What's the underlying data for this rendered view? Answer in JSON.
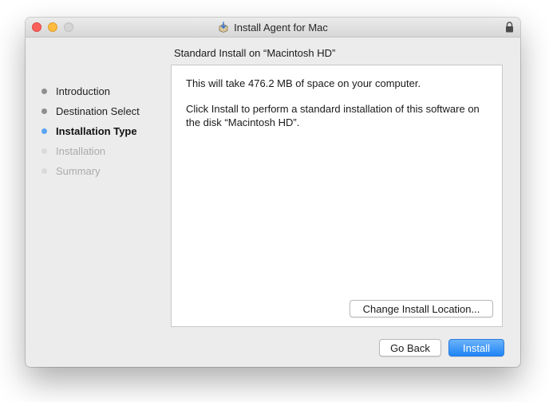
{
  "window": {
    "title": "Install Agent for Mac"
  },
  "section_title": "Standard Install on “Macintosh HD”",
  "steps": [
    {
      "label": "Introduction",
      "state": "done"
    },
    {
      "label": "Destination Select",
      "state": "done"
    },
    {
      "label": "Installation Type",
      "state": "current"
    },
    {
      "label": "Installation",
      "state": "pending"
    },
    {
      "label": "Summary",
      "state": "pending"
    }
  ],
  "content": {
    "line1": "This will take 476.2 MB of space on your computer.",
    "line2": "Click Install to perform a standard installation of this software on the disk “Macintosh HD”.",
    "change_location_label": "Change Install Location..."
  },
  "buttons": {
    "back_label": "Go Back",
    "install_label": "Install"
  },
  "colors": {
    "accent": "#1f84f5",
    "current_step": "#5aa5f2",
    "close": "#fc605b",
    "minimize": "#fdbc40"
  },
  "icons": {
    "app": "installer-package-icon",
    "lock": "lock-icon"
  }
}
